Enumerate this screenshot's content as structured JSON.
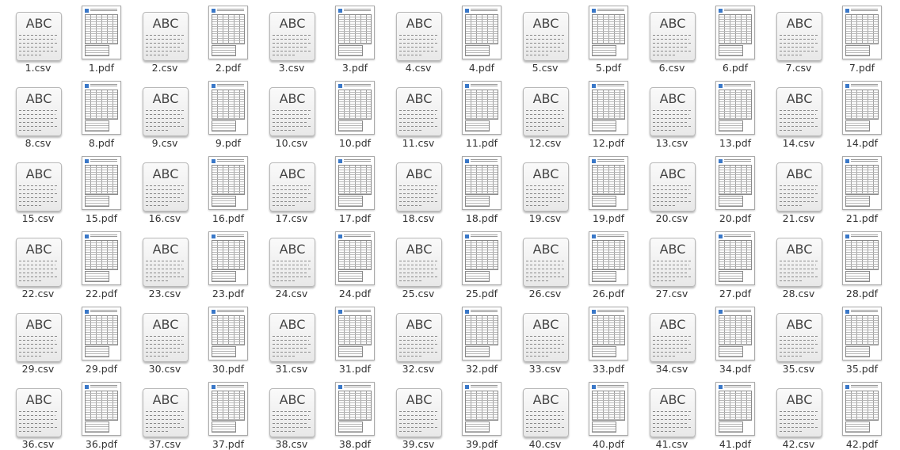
{
  "icon_glyphs": {
    "csv": "ABC"
  },
  "files": [
    "1.csv",
    "1.pdf",
    "2.csv",
    "2.pdf",
    "3.csv",
    "3.pdf",
    "4.csv",
    "4.pdf",
    "5.csv",
    "5.pdf",
    "6.csv",
    "6.pdf",
    "7.csv",
    "7.pdf",
    "8.csv",
    "8.pdf",
    "9.csv",
    "9.pdf",
    "10.csv",
    "10.pdf",
    "11.csv",
    "11.pdf",
    "12.csv",
    "12.pdf",
    "13.csv",
    "13.pdf",
    "14.csv",
    "14.pdf",
    "15.csv",
    "15.pdf",
    "16.csv",
    "16.pdf",
    "17.csv",
    "17.pdf",
    "18.csv",
    "18.pdf",
    "19.csv",
    "19.pdf",
    "20.csv",
    "20.pdf",
    "21.csv",
    "21.pdf",
    "22.csv",
    "22.pdf",
    "23.csv",
    "23.pdf",
    "24.csv",
    "24.pdf",
    "25.csv",
    "25.pdf",
    "26.csv",
    "26.pdf",
    "27.csv",
    "27.pdf",
    "28.csv",
    "28.pdf",
    "29.csv",
    "29.pdf",
    "30.csv",
    "30.pdf",
    "31.csv",
    "31.pdf",
    "32.csv",
    "32.pdf",
    "33.csv",
    "33.pdf",
    "34.csv",
    "34.pdf",
    "35.csv",
    "35.pdf",
    "36.csv",
    "36.pdf",
    "37.csv",
    "37.pdf",
    "38.csv",
    "38.pdf",
    "39.csv",
    "39.pdf",
    "40.csv",
    "40.pdf",
    "41.csv",
    "41.pdf",
    "42.csv",
    "42.pdf"
  ]
}
